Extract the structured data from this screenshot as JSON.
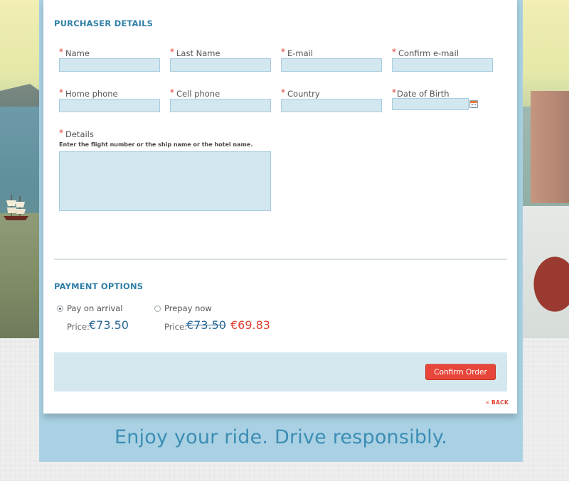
{
  "purchaser": {
    "title": "PURCHASER DETAILS",
    "required_mark": "*",
    "fields": {
      "name": "Name",
      "last_name": "Last Name",
      "email": "E-mail",
      "confirm_email": "Confirm e-mail",
      "home_phone": "Home phone",
      "cell_phone": "Cell phone",
      "country": "Country",
      "date_of_birth": "Date of Birth",
      "details": "Details"
    },
    "details_hint": "Enter the flight number or the ship name or the hotel name."
  },
  "payment": {
    "title": "PAYMENT OPTIONS",
    "pay_on_arrival": {
      "label": "Pay on arrival",
      "selected": true,
      "price_label": "Price:",
      "price": "€73.50"
    },
    "prepay_now": {
      "label": "Prepay now",
      "selected": false,
      "price_label": "Price:",
      "old_price": "€73.50",
      "new_price": "€69.83"
    }
  },
  "actions": {
    "confirm_label": "Confirm Order",
    "back_label": "« BACK"
  },
  "footer": {
    "slogan": "Enjoy your ride. Drive responsibly."
  },
  "colors": {
    "accent_blue": "#2f7fa8",
    "input_fill": "#d3e7f0",
    "confirm_red": "#e8463a",
    "frame_blue": "#a9d1e3"
  }
}
